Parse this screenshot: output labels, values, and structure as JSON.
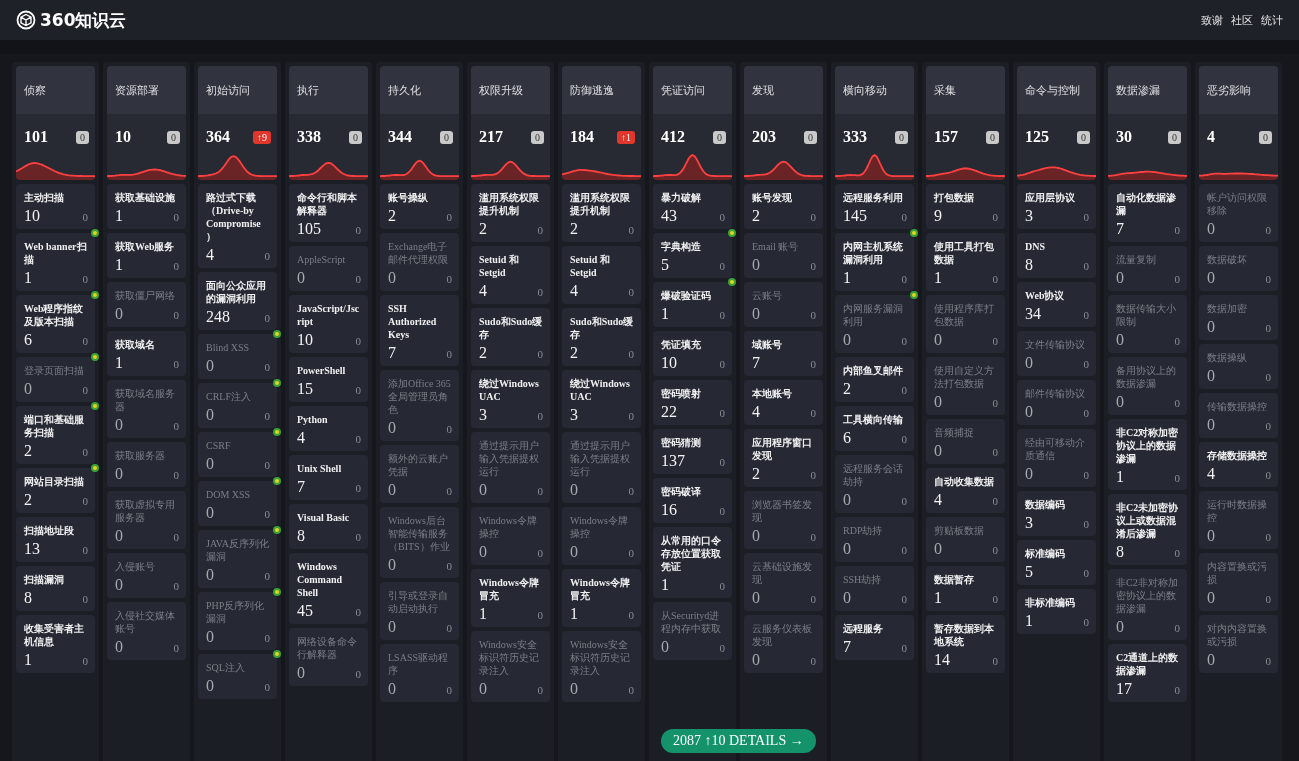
{
  "nav": {
    "logo": "360知识云",
    "links": [
      "致谢",
      "社区",
      "统计"
    ]
  },
  "columns": [
    {
      "title": "侦察",
      "count": "101",
      "change": "0",
      "up": false,
      "items": [
        {
          "name": "主动扫描",
          "count": "10",
          "new": "0",
          "dimmed": false,
          "dot": false
        },
        {
          "name": "Web banner扫描",
          "count": "1",
          "new": "0",
          "dimmed": false,
          "dot": true
        },
        {
          "name": "Web程序指纹及版本扫描",
          "count": "6",
          "new": "0",
          "dimmed": false,
          "dot": true
        },
        {
          "name": "登录页面扫描",
          "count": "0",
          "new": "0",
          "dimmed": true,
          "dot": true
        },
        {
          "name": "端口和基础服务扫描",
          "count": "2",
          "new": "0",
          "dimmed": false,
          "dot": true
        },
        {
          "name": "网站目录扫描",
          "count": "2",
          "new": "0",
          "dimmed": false,
          "dot": true
        },
        {
          "name": "扫描地址段",
          "count": "13",
          "new": "0",
          "dimmed": false,
          "dot": false
        },
        {
          "name": "扫描漏洞",
          "count": "8",
          "new": "0",
          "dimmed": false,
          "dot": false
        },
        {
          "name": "收集受害者主机信息",
          "count": "1",
          "new": "0",
          "dimmed": false,
          "dot": false
        }
      ]
    },
    {
      "title": "资源部署",
      "count": "10",
      "change": "0",
      "up": false,
      "items": [
        {
          "name": "获取基础设施",
          "count": "1",
          "new": "0",
          "dimmed": false,
          "dot": false
        },
        {
          "name": "获取Web服务",
          "count": "1",
          "new": "0",
          "dimmed": false,
          "dot": false
        },
        {
          "name": "获取僵尸网络",
          "count": "0",
          "new": "0",
          "dimmed": true,
          "dot": false
        },
        {
          "name": "获取域名",
          "count": "1",
          "new": "0",
          "dimmed": false,
          "dot": false
        },
        {
          "name": "获取域名服务器",
          "count": "0",
          "new": "0",
          "dimmed": true,
          "dot": false
        },
        {
          "name": "获取服务器",
          "count": "0",
          "new": "0",
          "dimmed": true,
          "dot": false
        },
        {
          "name": "获取虚拟专用服务器",
          "count": "0",
          "new": "0",
          "dimmed": true,
          "dot": false
        },
        {
          "name": "入侵账号",
          "count": "0",
          "new": "0",
          "dimmed": true,
          "dot": false
        },
        {
          "name": "入侵社交媒体账号",
          "count": "0",
          "new": "0",
          "dimmed": true,
          "dot": false
        }
      ]
    },
    {
      "title": "初始访问",
      "count": "364",
      "change": "↑9",
      "up": true,
      "items": [
        {
          "name": "路过式下载（Drive-by Compromise）",
          "count": "4",
          "new": "0",
          "dimmed": false,
          "dot": false
        },
        {
          "name": "面向公众应用的漏洞利用",
          "count": "248",
          "new": "0",
          "dimmed": false,
          "dot": false
        },
        {
          "name": "Blind XSS",
          "count": "0",
          "new": "0",
          "dimmed": true,
          "dot": true
        },
        {
          "name": "CRLF注入",
          "count": "0",
          "new": "0",
          "dimmed": true,
          "dot": true
        },
        {
          "name": "CSRF",
          "count": "0",
          "new": "0",
          "dimmed": true,
          "dot": true
        },
        {
          "name": "DOM XSS",
          "count": "0",
          "new": "0",
          "dimmed": true,
          "dot": true
        },
        {
          "name": "JAVA反序列化漏洞",
          "count": "0",
          "new": "0",
          "dimmed": true,
          "dot": true
        },
        {
          "name": "PHP反序列化漏洞",
          "count": "0",
          "new": "0",
          "dimmed": true,
          "dot": true
        },
        {
          "name": "SQL注入",
          "count": "0",
          "new": "0",
          "dimmed": true,
          "dot": true
        }
      ]
    },
    {
      "title": "执行",
      "count": "338",
      "change": "0",
      "up": false,
      "items": [
        {
          "name": "命令行和脚本解释器",
          "count": "105",
          "new": "0",
          "dimmed": false,
          "dot": false
        },
        {
          "name": "AppleScript",
          "count": "0",
          "new": "0",
          "dimmed": true,
          "dot": false
        },
        {
          "name": "JavaScript/Jscript",
          "count": "10",
          "new": "0",
          "dimmed": false,
          "dot": false
        },
        {
          "name": "PowerShell",
          "count": "15",
          "new": "0",
          "dimmed": false,
          "dot": false
        },
        {
          "name": "Python",
          "count": "4",
          "new": "0",
          "dimmed": false,
          "dot": false
        },
        {
          "name": "Unix Shell",
          "count": "7",
          "new": "0",
          "dimmed": false,
          "dot": false
        },
        {
          "name": "Visual Basic",
          "count": "8",
          "new": "0",
          "dimmed": false,
          "dot": false
        },
        {
          "name": "Windows Command Shell",
          "count": "45",
          "new": "0",
          "dimmed": false,
          "dot": false
        },
        {
          "name": "网络设备命令行解释器",
          "count": "0",
          "new": "0",
          "dimmed": true,
          "dot": false
        }
      ]
    },
    {
      "title": "持久化",
      "count": "344",
      "change": "0",
      "up": false,
      "items": [
        {
          "name": "账号操纵",
          "count": "2",
          "new": "0",
          "dimmed": false,
          "dot": false
        },
        {
          "name": "Exchange电子邮件代理权限",
          "count": "0",
          "new": "0",
          "dimmed": true,
          "dot": false
        },
        {
          "name": "SSH Authorized Keys",
          "count": "7",
          "new": "0",
          "dimmed": false,
          "dot": false
        },
        {
          "name": "添加Office 365全局管理员角色",
          "count": "0",
          "new": "0",
          "dimmed": true,
          "dot": false
        },
        {
          "name": "额外的云账户凭据",
          "count": "0",
          "new": "0",
          "dimmed": true,
          "dot": false
        },
        {
          "name": "Windows后台智能传输服务（BITS）作业",
          "count": "0",
          "new": "0",
          "dimmed": true,
          "dot": false
        },
        {
          "name": "引导或登录自动启动执行",
          "count": "0",
          "new": "0",
          "dimmed": true,
          "dot": false
        },
        {
          "name": "LSASS驱动程序",
          "count": "0",
          "new": "0",
          "dimmed": true,
          "dot": false
        }
      ]
    },
    {
      "title": "权限升级",
      "count": "217",
      "change": "0",
      "up": false,
      "items": [
        {
          "name": "滥用系统权限提升机制",
          "count": "2",
          "new": "0",
          "dimmed": false,
          "dot": false
        },
        {
          "name": "Setuid 和 Setgid",
          "count": "4",
          "new": "0",
          "dimmed": false,
          "dot": false
        },
        {
          "name": "Sudo和Sudo缓存",
          "count": "2",
          "new": "0",
          "dimmed": false,
          "dot": false
        },
        {
          "name": "绕过Windows UAC",
          "count": "3",
          "new": "0",
          "dimmed": false,
          "dot": false
        },
        {
          "name": "通过提示用户输入凭据提权运行",
          "count": "0",
          "new": "0",
          "dimmed": true,
          "dot": false
        },
        {
          "name": "Windows令牌操控",
          "count": "0",
          "new": "0",
          "dimmed": true,
          "dot": false
        },
        {
          "name": "Windows令牌冒充",
          "count": "1",
          "new": "0",
          "dimmed": false,
          "dot": false
        },
        {
          "name": "Windows安全标识符历史记录注入",
          "count": "0",
          "new": "0",
          "dimmed": true,
          "dot": false
        }
      ]
    },
    {
      "title": "防御逃逸",
      "count": "184",
      "change": "↑1",
      "up": true,
      "items": [
        {
          "name": "滥用系统权限提升机制",
          "count": "2",
          "new": "0",
          "dimmed": false,
          "dot": false
        },
        {
          "name": "Setuid 和 Setgid",
          "count": "4",
          "new": "0",
          "dimmed": false,
          "dot": false
        },
        {
          "name": "Sudo和Sudo缓存",
          "count": "2",
          "new": "0",
          "dimmed": false,
          "dot": false
        },
        {
          "name": "绕过Windows UAC",
          "count": "3",
          "new": "0",
          "dimmed": false,
          "dot": false
        },
        {
          "name": "通过提示用户输入凭据提权运行",
          "count": "0",
          "new": "0",
          "dimmed": true,
          "dot": false
        },
        {
          "name": "Windows令牌操控",
          "count": "0",
          "new": "0",
          "dimmed": true,
          "dot": false
        },
        {
          "name": "Windows令牌冒充",
          "count": "1",
          "new": "0",
          "dimmed": false,
          "dot": false
        },
        {
          "name": "Windows安全标识符历史记录注入",
          "count": "0",
          "new": "0",
          "dimmed": true,
          "dot": false
        }
      ]
    },
    {
      "title": "凭证访问",
      "count": "412",
      "change": "0",
      "up": false,
      "items": [
        {
          "name": "暴力破解",
          "count": "43",
          "new": "0",
          "dimmed": false,
          "dot": false
        },
        {
          "name": "字典构造",
          "count": "5",
          "new": "0",
          "dimmed": false,
          "dot": true
        },
        {
          "name": "爆破验证码",
          "count": "1",
          "new": "0",
          "dimmed": false,
          "dot": true
        },
        {
          "name": "凭证填充",
          "count": "10",
          "new": "0",
          "dimmed": false,
          "dot": false
        },
        {
          "name": "密码喷射",
          "count": "22",
          "new": "0",
          "dimmed": false,
          "dot": false
        },
        {
          "name": "密码猜测",
          "count": "137",
          "new": "0",
          "dimmed": false,
          "dot": false
        },
        {
          "name": "密码破译",
          "count": "16",
          "new": "0",
          "dimmed": false,
          "dot": false
        },
        {
          "name": "从常用的口令存放位置获取凭证",
          "count": "1",
          "new": "0",
          "dimmed": false,
          "dot": false
        },
        {
          "name": "从Securityd进程内存中获取",
          "count": "0",
          "new": "0",
          "dimmed": true,
          "dot": false
        }
      ]
    },
    {
      "title": "发现",
      "count": "203",
      "change": "0",
      "up": false,
      "items": [
        {
          "name": "账号发现",
          "count": "2",
          "new": "0",
          "dimmed": false,
          "dot": false
        },
        {
          "name": "Email 账号",
          "count": "0",
          "new": "0",
          "dimmed": true,
          "dot": false
        },
        {
          "name": "云账号",
          "count": "0",
          "new": "0",
          "dimmed": true,
          "dot": false
        },
        {
          "name": "域账号",
          "count": "7",
          "new": "0",
          "dimmed": false,
          "dot": false
        },
        {
          "name": "本地账号",
          "count": "4",
          "new": "0",
          "dimmed": false,
          "dot": false
        },
        {
          "name": "应用程序窗口发现",
          "count": "2",
          "new": "0",
          "dimmed": false,
          "dot": false
        },
        {
          "name": "浏览器书签发现",
          "count": "0",
          "new": "0",
          "dimmed": true,
          "dot": false
        },
        {
          "name": "云基础设施发现",
          "count": "0",
          "new": "0",
          "dimmed": true,
          "dot": false
        },
        {
          "name": "云服务仪表板发现",
          "count": "0",
          "new": "0",
          "dimmed": true,
          "dot": false
        }
      ]
    },
    {
      "title": "横向移动",
      "count": "333",
      "change": "0",
      "up": false,
      "items": [
        {
          "name": "远程服务利用",
          "count": "145",
          "new": "0",
          "dimmed": false,
          "dot": false
        },
        {
          "name": "内网主机系统漏洞利用",
          "count": "1",
          "new": "0",
          "dimmed": false,
          "dot": true
        },
        {
          "name": "内网服务漏洞利用",
          "count": "0",
          "new": "0",
          "dimmed": true,
          "dot": true
        },
        {
          "name": "内部鱼叉邮件",
          "count": "2",
          "new": "0",
          "dimmed": false,
          "dot": false
        },
        {
          "name": "工具横向传输",
          "count": "6",
          "new": "0",
          "dimmed": false,
          "dot": false
        },
        {
          "name": "远程服务会话劫持",
          "count": "0",
          "new": "0",
          "dimmed": true,
          "dot": false
        },
        {
          "name": "RDP劫持",
          "count": "0",
          "new": "0",
          "dimmed": true,
          "dot": false
        },
        {
          "name": "SSH劫持",
          "count": "0",
          "new": "0",
          "dimmed": true,
          "dot": false
        },
        {
          "name": "远程服务",
          "count": "7",
          "new": "0",
          "dimmed": false,
          "dot": false
        }
      ]
    },
    {
      "title": "采集",
      "count": "157",
      "change": "0",
      "up": false,
      "items": [
        {
          "name": "打包数据",
          "count": "9",
          "new": "0",
          "dimmed": false,
          "dot": false
        },
        {
          "name": "使用工具打包数据",
          "count": "1",
          "new": "0",
          "dimmed": false,
          "dot": false
        },
        {
          "name": "使用程序库打包数据",
          "count": "0",
          "new": "0",
          "dimmed": true,
          "dot": false
        },
        {
          "name": "使用自定义方法打包数据",
          "count": "0",
          "new": "0",
          "dimmed": true,
          "dot": false
        },
        {
          "name": "音频捕捉",
          "count": "0",
          "new": "0",
          "dimmed": true,
          "dot": false
        },
        {
          "name": "自动收集数据",
          "count": "4",
          "new": "0",
          "dimmed": false,
          "dot": false
        },
        {
          "name": "剪贴板数据",
          "count": "0",
          "new": "0",
          "dimmed": true,
          "dot": false
        },
        {
          "name": "数据暂存",
          "count": "1",
          "new": "0",
          "dimmed": false,
          "dot": false
        },
        {
          "name": "暂存数据到本地系统",
          "count": "14",
          "new": "0",
          "dimmed": false,
          "dot": false
        }
      ]
    },
    {
      "title": "命令与控制",
      "count": "125",
      "change": "0",
      "up": false,
      "items": [
        {
          "name": "应用层协议",
          "count": "3",
          "new": "0",
          "dimmed": false,
          "dot": false
        },
        {
          "name": "DNS",
          "count": "8",
          "new": "0",
          "dimmed": false,
          "dot": false
        },
        {
          "name": "Web协议",
          "count": "34",
          "new": "0",
          "dimmed": false,
          "dot": false
        },
        {
          "name": "文件传输协议",
          "count": "0",
          "new": "0",
          "dimmed": true,
          "dot": false
        },
        {
          "name": "邮件传输协议",
          "count": "0",
          "new": "0",
          "dimmed": true,
          "dot": false
        },
        {
          "name": "经由可移动介质通信",
          "count": "0",
          "new": "0",
          "dimmed": true,
          "dot": false
        },
        {
          "name": "数据编码",
          "count": "3",
          "new": "0",
          "dimmed": false,
          "dot": false
        },
        {
          "name": "标准编码",
          "count": "5",
          "new": "0",
          "dimmed": false,
          "dot": false
        },
        {
          "name": "非标准编码",
          "count": "1",
          "new": "0",
          "dimmed": false,
          "dot": false
        }
      ]
    },
    {
      "title": "数据渗漏",
      "count": "30",
      "change": "0",
      "up": false,
      "items": [
        {
          "name": "自动化数据渗漏",
          "count": "7",
          "new": "0",
          "dimmed": false,
          "dot": false
        },
        {
          "name": "流量复制",
          "count": "0",
          "new": "0",
          "dimmed": true,
          "dot": false
        },
        {
          "name": "数据传输大小限制",
          "count": "0",
          "new": "0",
          "dimmed": true,
          "dot": false
        },
        {
          "name": "备用协议上的数据渗漏",
          "count": "0",
          "new": "0",
          "dimmed": true,
          "dot": false
        },
        {
          "name": "非C2对称加密协议上的数据渗漏",
          "count": "1",
          "new": "0",
          "dimmed": false,
          "dot": false
        },
        {
          "name": "非C2未加密协议上或数据混淆后渗漏",
          "count": "8",
          "new": "0",
          "dimmed": false,
          "dot": false
        },
        {
          "name": "非C2非对称加密协议上的数据渗漏",
          "count": "0",
          "new": "0",
          "dimmed": true,
          "dot": false
        },
        {
          "name": "C2通道上的数据渗漏",
          "count": "17",
          "new": "0",
          "dimmed": false,
          "dot": false
        }
      ]
    },
    {
      "title": "恶劣影响",
      "count": "4",
      "change": "0",
      "up": false,
      "items": [
        {
          "name": "帐户访问权限移除",
          "count": "0",
          "new": "0",
          "dimmed": true,
          "dot": false
        },
        {
          "name": "数据破坏",
          "count": "0",
          "new": "0",
          "dimmed": true,
          "dot": false
        },
        {
          "name": "数据加密",
          "count": "0",
          "new": "0",
          "dimmed": true,
          "dot": false
        },
        {
          "name": "数据操纵",
          "count": "0",
          "new": "0",
          "dimmed": true,
          "dot": false
        },
        {
          "name": "传输数据操控",
          "count": "0",
          "new": "0",
          "dimmed": true,
          "dot": false
        },
        {
          "name": "存储数据操控",
          "count": "4",
          "new": "0",
          "dimmed": false,
          "dot": false
        },
        {
          "name": "运行时数据操控",
          "count": "0",
          "new": "0",
          "dimmed": true,
          "dot": false
        },
        {
          "name": "内容置换或污损",
          "count": "0",
          "new": "0",
          "dimmed": true,
          "dot": false
        },
        {
          "name": "对内内容置换或污损",
          "count": "0",
          "new": "0",
          "dimmed": true,
          "dot": false
        }
      ]
    }
  ],
  "details_button": "2087 ↑10 DETAILS →"
}
